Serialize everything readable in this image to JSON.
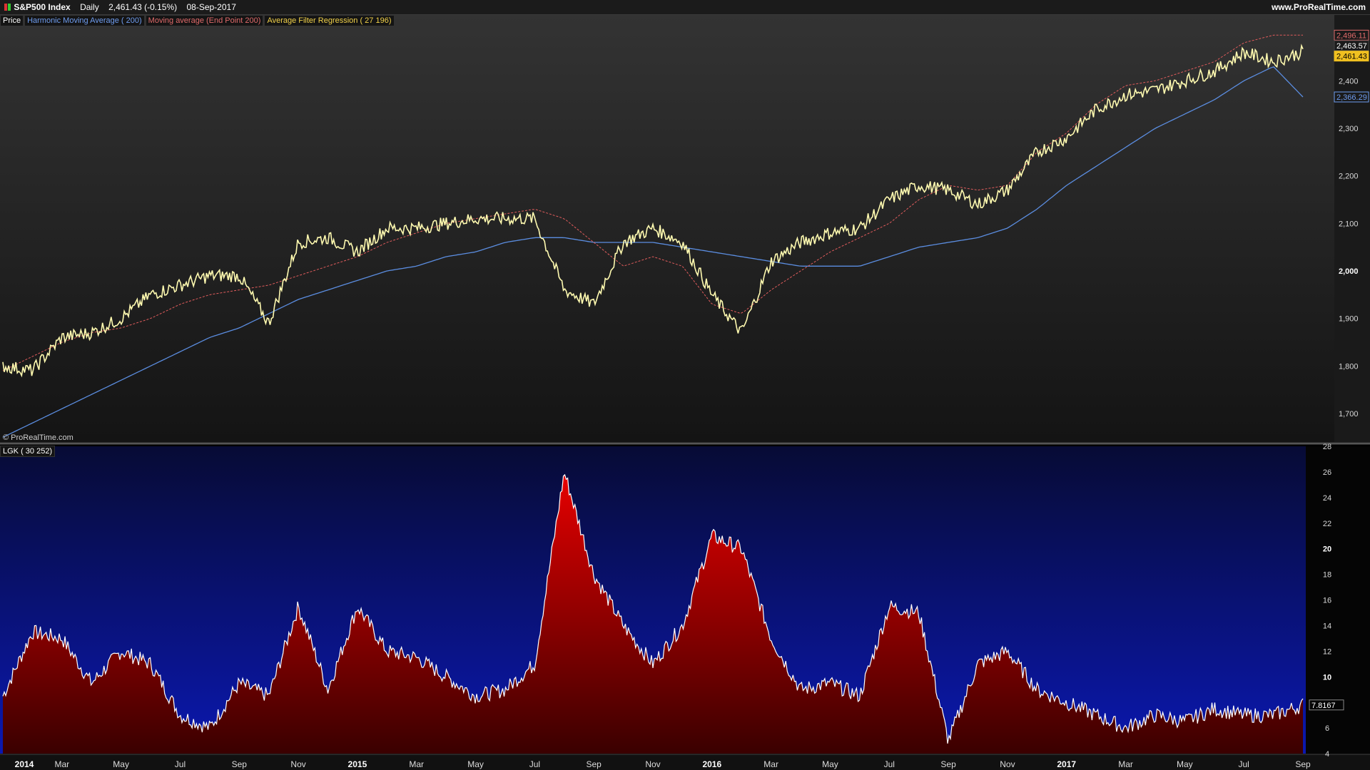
{
  "header": {
    "instrument": "S&P500 Index",
    "period": "Daily",
    "last": "2,461.43 (-0.15%)",
    "date": "08-Sep-2017",
    "site": "www.ProRealTime.com"
  },
  "legend": {
    "price": "Price",
    "hma": "Harmonic Moving Average ( 200)",
    "ma": "Moving average (End Point 200)",
    "afr": "Average Filter Regression ( 27 196)",
    "lgk": "LGK ( 30 252)"
  },
  "copyright": "© ProRealTime.com",
  "colors": {
    "price": "#fffab0",
    "hma": "#5b8de0",
    "ma": "#e05c5c",
    "afr_badge": "#f0c020",
    "lgk_fill": "#c00000",
    "lgk_line": "#ffffff"
  },
  "badges": {
    "ma": "2,496.11",
    "afr": "2,463.57",
    "price": "2,461.43",
    "hma": "2,366.29",
    "lgk": "7.8167"
  },
  "chart_data": [
    {
      "type": "line",
      "name": "price-panel",
      "ylim": [
        1640,
        2540
      ],
      "y_ticks": [
        "1,700",
        "1,800",
        "1,900",
        "2,000",
        "2,100",
        "2,200",
        "2,300",
        "2,400"
      ],
      "x_ticks": [
        "2014",
        "Mar",
        "May",
        "Jul",
        "Sep",
        "Nov",
        "2015",
        "Mar",
        "May",
        "Jul",
        "Sep",
        "Nov",
        "2016",
        "Mar",
        "May",
        "Jul",
        "Sep",
        "Nov",
        "2017",
        "Mar",
        "May",
        "Jul",
        "Sep"
      ],
      "x": [
        "2014-01",
        "2014-02",
        "2014-03",
        "2014-04",
        "2014-05",
        "2014-06",
        "2014-07",
        "2014-08",
        "2014-09",
        "2014-10",
        "2014-11",
        "2014-12",
        "2015-01",
        "2015-02",
        "2015-03",
        "2015-04",
        "2015-05",
        "2015-06",
        "2015-07",
        "2015-08",
        "2015-09",
        "2015-10",
        "2015-11",
        "2015-12",
        "2016-01",
        "2016-02",
        "2016-03",
        "2016-04",
        "2016-05",
        "2016-06",
        "2016-07",
        "2016-08",
        "2016-09",
        "2016-10",
        "2016-11",
        "2016-12",
        "2017-01",
        "2017-02",
        "2017-03",
        "2017-04",
        "2017-05",
        "2017-06",
        "2017-07",
        "2017-08",
        "2017-09"
      ],
      "series": [
        {
          "name": "Price",
          "values": [
            1800,
            1790,
            1860,
            1870,
            1900,
            1950,
            1970,
            1990,
            1990,
            1890,
            2060,
            2070,
            2040,
            2090,
            2090,
            2100,
            2110,
            2110,
            2110,
            1960,
            1930,
            2060,
            2090,
            2060,
            1950,
            1870,
            2020,
            2060,
            2080,
            2090,
            2150,
            2180,
            2170,
            2140,
            2170,
            2250,
            2280,
            2340,
            2370,
            2380,
            2400,
            2420,
            2460,
            2440,
            2461
          ]
        },
        {
          "name": "Harmonic Moving Average ( 200)",
          "values": [
            1650,
            1680,
            1710,
            1740,
            1770,
            1800,
            1830,
            1860,
            1880,
            1910,
            1940,
            1960,
            1980,
            2000,
            2010,
            2030,
            2040,
            2060,
            2070,
            2070,
            2060,
            2060,
            2060,
            2050,
            2040,
            2030,
            2020,
            2010,
            2010,
            2010,
            2030,
            2050,
            2060,
            2070,
            2090,
            2130,
            2180,
            2220,
            2260,
            2300,
            2330,
            2360,
            2400,
            2430,
            2366
          ]
        },
        {
          "name": "Moving average (End Point 200)",
          "values": [
            1790,
            1820,
            1850,
            1870,
            1880,
            1900,
            1930,
            1950,
            1960,
            1970,
            1990,
            2010,
            2030,
            2060,
            2080,
            2100,
            2110,
            2120,
            2130,
            2110,
            2060,
            2010,
            2030,
            2010,
            1930,
            1910,
            1960,
            2000,
            2040,
            2070,
            2100,
            2150,
            2180,
            2170,
            2180,
            2250,
            2290,
            2350,
            2390,
            2400,
            2420,
            2440,
            2480,
            2496,
            2496
          ]
        }
      ]
    },
    {
      "type": "area",
      "name": "LGK ( 30 252)",
      "ylim": [
        4,
        28
      ],
      "y_ticks": [
        "4",
        "6",
        "8",
        "10",
        "12",
        "14",
        "16",
        "18",
        "20",
        "22",
        "24",
        "26",
        "28"
      ],
      "x": [
        "2014-01",
        "2014-02",
        "2014-03",
        "2014-04",
        "2014-05",
        "2014-06",
        "2014-07",
        "2014-08",
        "2014-09",
        "2014-10",
        "2014-11",
        "2014-12",
        "2015-01",
        "2015-02",
        "2015-03",
        "2015-04",
        "2015-05",
        "2015-06",
        "2015-07",
        "2015-08",
        "2015-09",
        "2015-10",
        "2015-11",
        "2015-12",
        "2016-01",
        "2016-02",
        "2016-03",
        "2016-04",
        "2016-05",
        "2016-06",
        "2016-07",
        "2016-08",
        "2016-09",
        "2016-10",
        "2016-11",
        "2016-12",
        "2017-01",
        "2017-02",
        "2017-03",
        "2017-04",
        "2017-05",
        "2017-06",
        "2017-07",
        "2017-08",
        "2017-09"
      ],
      "values": [
        8.5,
        13.5,
        13,
        9.5,
        12,
        11,
        7,
        6,
        9.5,
        8.5,
        15.5,
        9,
        15.5,
        12,
        11.5,
        10,
        8.5,
        9,
        11,
        26,
        18,
        14,
        11,
        14,
        21,
        20,
        13,
        9,
        9.5,
        8.5,
        15.5,
        15,
        5,
        11,
        12,
        9,
        8,
        7,
        6,
        7,
        6.5,
        7.5,
        7,
        7,
        7.8
      ]
    }
  ]
}
